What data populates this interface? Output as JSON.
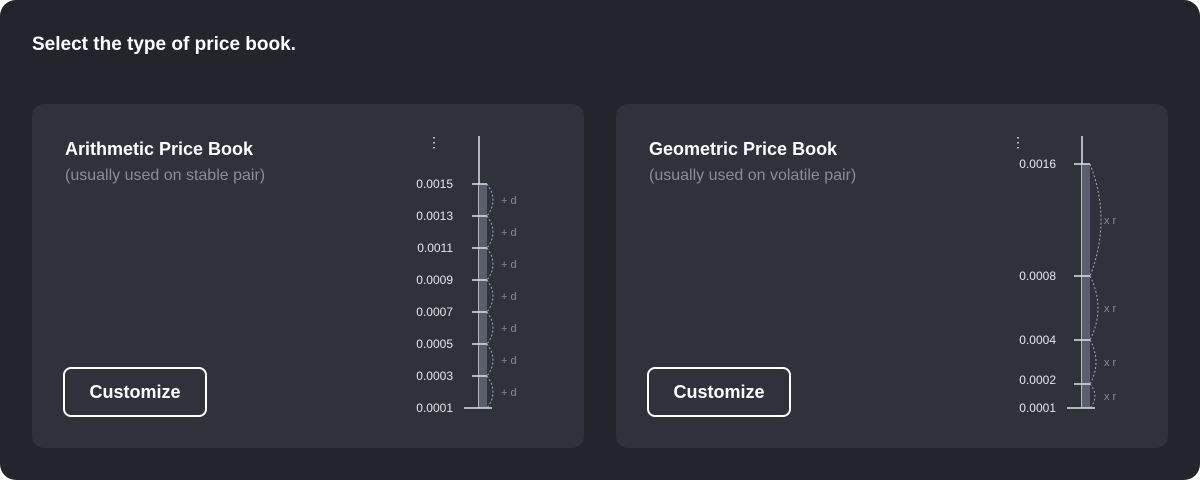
{
  "page": {
    "heading": "Select the type of price book."
  },
  "cards": {
    "arithmetic": {
      "title": "Arithmetic Price Book",
      "subtitle": "(usually used on stable pair)",
      "button_label": "Customize",
      "more_icon": "vertical-ellipsis-icon",
      "more_glyph": "⋮",
      "scale": {
        "ticks": [
          "0.0015",
          "0.0013",
          "0.0011",
          "0.0009",
          "0.0007",
          "0.0005",
          "0.0003",
          "0.0001"
        ],
        "step_label": "+ d"
      }
    },
    "geometric": {
      "title": "Geometric Price Book",
      "subtitle": "(usually used on volatile pair)",
      "button_label": "Customize",
      "more_icon": "vertical-ellipsis-icon",
      "more_glyph": "⋮",
      "scale": {
        "ticks": [
          "0.0016",
          "0.0008",
          "0.0004",
          "0.0002",
          "0.0001"
        ],
        "step_label": "x r"
      }
    }
  },
  "colors": {
    "background": "#23252d",
    "card": "#2f313b",
    "text": "#ffffff",
    "muted": "#8a8d99"
  }
}
